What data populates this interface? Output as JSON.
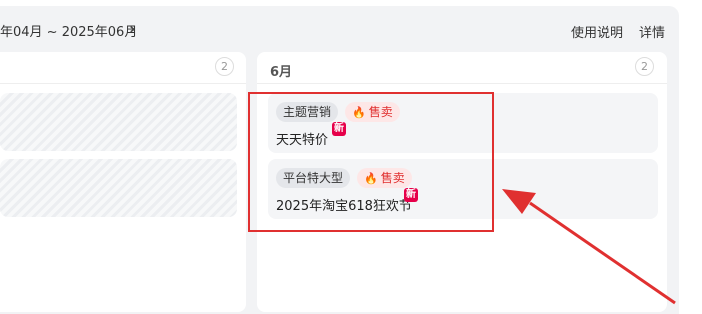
{
  "header": {
    "date_range": "年04月 ~ 2025年06月",
    "chevron": "›",
    "help_link": "使用说明",
    "details_link": "详情"
  },
  "columns": [
    {
      "title": "",
      "count": "2"
    },
    {
      "title": "6月",
      "count": "2"
    }
  ],
  "cards": [
    {
      "topic_tag": "主题营销",
      "sale_tag": "售卖",
      "title": "天天特价",
      "badge": "新"
    },
    {
      "topic_tag": "平台特大型",
      "sale_tag": "售卖",
      "title": "2025年淘宝618狂欢节",
      "badge": "新"
    }
  ],
  "colors": {
    "highlight": "#e03030",
    "sale_text": "#e02e2e",
    "new_badge": "#e6004a"
  },
  "icons": {
    "sale_tag_icon": "flame-icon",
    "next_icon": "chevron-right-icon"
  }
}
